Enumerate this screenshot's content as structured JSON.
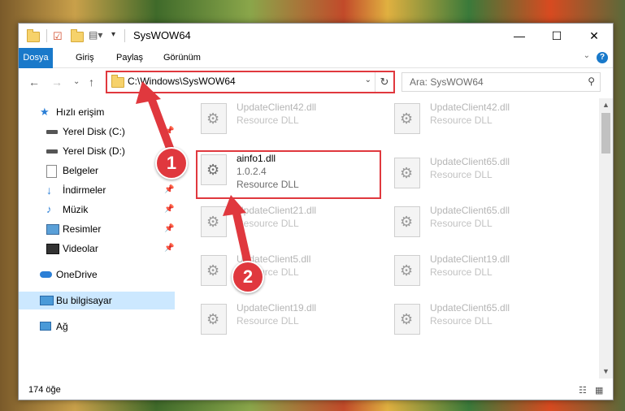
{
  "window": {
    "title": "SysWOW64"
  },
  "ribbon": {
    "tabs": [
      "Dosya",
      "Giriş",
      "Paylaş",
      "Görünüm"
    ],
    "help": "?"
  },
  "address": {
    "path": "C:\\Windows\\SysWOW64",
    "search_placeholder": "Ara: SysWOW64"
  },
  "sidebar": {
    "items": [
      {
        "label": "Hızlı erişim",
        "icon": "star-icon",
        "pinned": false
      },
      {
        "label": "Yerel Disk (C:)",
        "icon": "drive-icon",
        "pinned": true
      },
      {
        "label": "Yerel Disk (D:)",
        "icon": "drive-icon",
        "pinned": true
      },
      {
        "label": "Belgeler",
        "icon": "documents-icon",
        "pinned": true
      },
      {
        "label": "İndirmeler",
        "icon": "download-icon",
        "pinned": true
      },
      {
        "label": "Müzik",
        "icon": "music-icon",
        "pinned": true
      },
      {
        "label": "Resimler",
        "icon": "pictures-icon",
        "pinned": true
      },
      {
        "label": "Videolar",
        "icon": "videos-icon",
        "pinned": true
      },
      {
        "label": "OneDrive",
        "icon": "cloud-icon",
        "pinned": false
      },
      {
        "label": "Bu bilgisayar",
        "icon": "computer-icon",
        "pinned": false
      },
      {
        "label": "Ağ",
        "icon": "network-icon",
        "pinned": false
      }
    ]
  },
  "files": {
    "left": [
      {
        "name": "UpdateClient42.dll",
        "type": "Resource DLL"
      },
      {
        "name": "ainfo1.dll",
        "version": "1.0.2.4",
        "type": "Resource DLL"
      },
      {
        "name": "UpdateClient21.dll",
        "type": "Resource DLL"
      },
      {
        "name": "UpdateClient5.dll",
        "type": "Resource DLL"
      },
      {
        "name": "UpdateClient19.dll",
        "type": "Resource DLL"
      }
    ],
    "right": [
      {
        "name": "UpdateClient42.dll",
        "type": "Resource DLL"
      },
      {
        "name": "UpdateClient65.dll",
        "type": "Resource DLL"
      },
      {
        "name": "UpdateClient65.dll",
        "type": "Resource DLL"
      },
      {
        "name": "UpdateClient19.dll",
        "type": "Resource DLL"
      },
      {
        "name": "UpdateClient65.dll",
        "type": "Resource DLL"
      }
    ]
  },
  "status": {
    "count": "174 öğe"
  },
  "callouts": [
    "1",
    "2"
  ],
  "colors": {
    "accent": "#1979ca",
    "highlight": "#e0383e",
    "selected": "#cce8ff"
  }
}
